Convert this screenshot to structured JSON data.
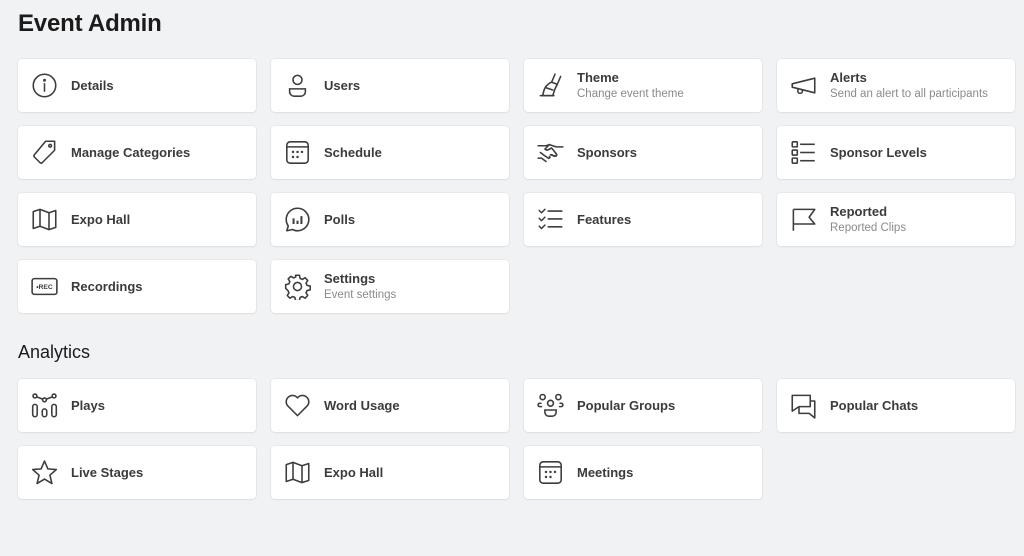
{
  "page": {
    "title": "Event Admin"
  },
  "admin": {
    "items": [
      {
        "label": "Details",
        "subtitle": "",
        "icon": "info-icon"
      },
      {
        "label": "Users",
        "subtitle": "",
        "icon": "user-icon"
      },
      {
        "label": "Theme",
        "subtitle": "Change event theme",
        "icon": "paintbrush-icon"
      },
      {
        "label": "Alerts",
        "subtitle": "Send an alert to all participants",
        "icon": "megaphone-icon"
      },
      {
        "label": "Manage Categories",
        "subtitle": "",
        "icon": "tag-icon"
      },
      {
        "label": "Schedule",
        "subtitle": "",
        "icon": "calendar-icon"
      },
      {
        "label": "Sponsors",
        "subtitle": "",
        "icon": "handshake-icon"
      },
      {
        "label": "Sponsor Levels",
        "subtitle": "",
        "icon": "list-icon"
      },
      {
        "label": "Expo Hall",
        "subtitle": "",
        "icon": "map-icon"
      },
      {
        "label": "Polls",
        "subtitle": "",
        "icon": "poll-chat-icon"
      },
      {
        "label": "Features",
        "subtitle": "",
        "icon": "checklist-icon"
      },
      {
        "label": "Reported",
        "subtitle": "Reported Clips",
        "icon": "flag-icon"
      },
      {
        "label": "Recordings",
        "subtitle": "",
        "icon": "rec-icon",
        "icon_text": "•REC"
      },
      {
        "label": "Settings",
        "subtitle": "Event settings",
        "icon": "gear-icon"
      }
    ]
  },
  "analytics": {
    "title": "Analytics",
    "items": [
      {
        "label": "Plays",
        "subtitle": "",
        "icon": "chart-icon"
      },
      {
        "label": "Word Usage",
        "subtitle": "",
        "icon": "heart-icon"
      },
      {
        "label": "Popular Groups",
        "subtitle": "",
        "icon": "group-icon"
      },
      {
        "label": "Popular Chats",
        "subtitle": "",
        "icon": "chat-icon"
      },
      {
        "label": "Live Stages",
        "subtitle": "",
        "icon": "star-icon"
      },
      {
        "label": "Expo Hall",
        "subtitle": "",
        "icon": "map-icon"
      },
      {
        "label": "Meetings",
        "subtitle": "",
        "icon": "calendar-icon"
      }
    ]
  }
}
